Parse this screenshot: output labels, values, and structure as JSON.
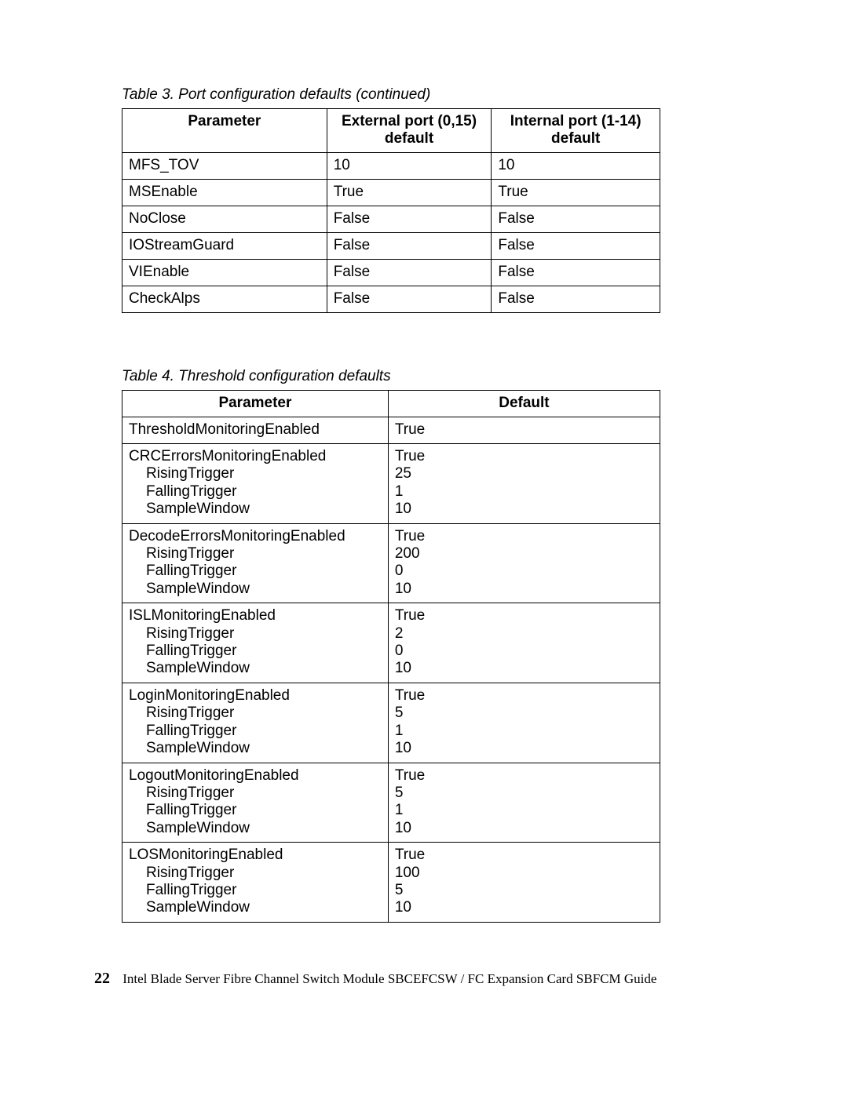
{
  "table3": {
    "caption": "Table 3. Port configuration defaults (continued)",
    "headers": {
      "c1": "Parameter",
      "c2": "External port (0,15) default",
      "c3": "Internal port (1-14) default"
    },
    "rows": [
      {
        "p": "MFS_TOV",
        "ext": "10",
        "int": "10"
      },
      {
        "p": "MSEnable",
        "ext": "True",
        "int": "True"
      },
      {
        "p": "NoClose",
        "ext": "False",
        "int": "False"
      },
      {
        "p": "IOStreamGuard",
        "ext": "False",
        "int": "False"
      },
      {
        "p": "VIEnable",
        "ext": "False",
        "int": "False"
      },
      {
        "p": "CheckAlps",
        "ext": "False",
        "int": "False"
      }
    ]
  },
  "table4": {
    "caption": "Table 4. Threshold configuration defaults",
    "headers": {
      "c1": "Parameter",
      "c2": "Default"
    },
    "sub": {
      "rt": "RisingTrigger",
      "ft": "FallingTrigger",
      "sw": "SampleWindow"
    },
    "rows": [
      {
        "p": "ThresholdMonitoringEnabled",
        "v": "True"
      },
      {
        "p": "CRCErrorsMonitoringEnabled",
        "v": "True",
        "rt": "25",
        "ft": "1",
        "sw": "10"
      },
      {
        "p": "DecodeErrorsMonitoringEnabled",
        "v": "True",
        "rt": "200",
        "ft": "0",
        "sw": "10"
      },
      {
        "p": "ISLMonitoringEnabled",
        "v": "True",
        "rt": "2",
        "ft": "0",
        "sw": "10"
      },
      {
        "p": "LoginMonitoringEnabled",
        "v": "True",
        "rt": "5",
        "ft": "1",
        "sw": "10"
      },
      {
        "p": "LogoutMonitoringEnabled",
        "v": "True",
        "rt": "5",
        "ft": "1",
        "sw": "10"
      },
      {
        "p": "LOSMonitoringEnabled",
        "v": "True",
        "rt": "100",
        "ft": "5",
        "sw": "10"
      }
    ]
  },
  "footer": {
    "page": "22",
    "title": "Intel Blade Server Fibre Channel Switch Module SBCEFCSW / FC Expansion Card SBFCM Guide"
  }
}
